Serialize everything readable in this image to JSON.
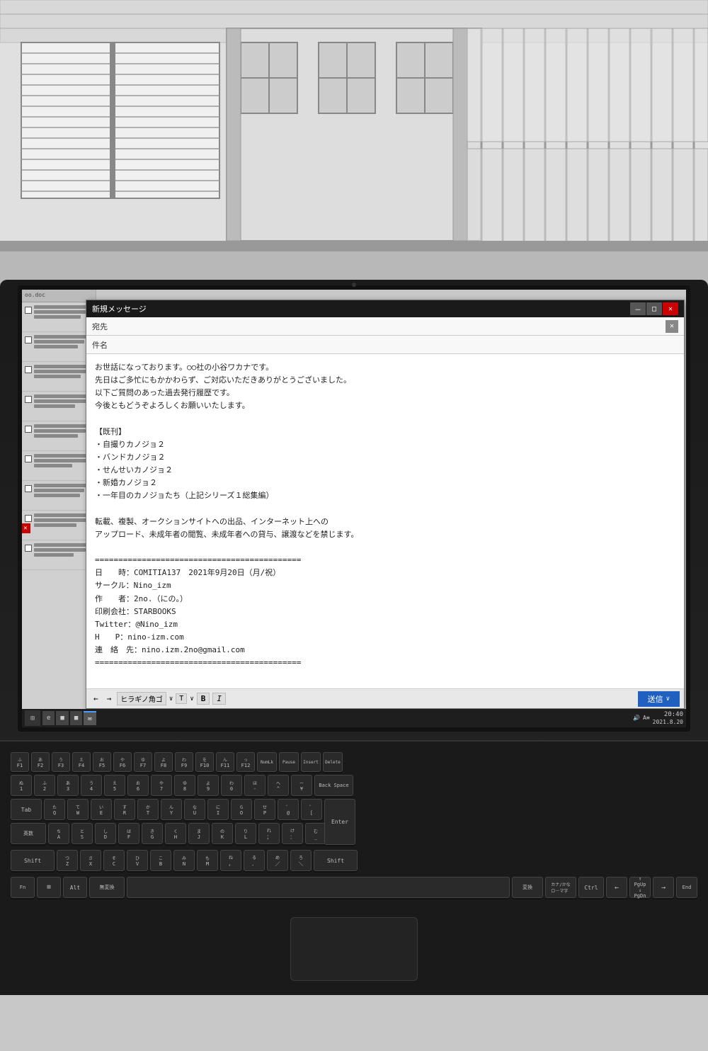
{
  "scene": {
    "background": "manga-style building interior with venetian blinds and windows"
  },
  "window": {
    "title": "新規メッセージ",
    "minimize_label": "－",
    "maximize_label": "□",
    "close_label": "✕"
  },
  "email": {
    "to_label": "宛先",
    "subject_label": "件名",
    "to_value": "",
    "subject_value": "",
    "close_x": "✕",
    "body": "お世話になっております。○○社の小谷ワカナです。\n先日はご多忙にもかかわらず、ご対応いただきありがとうございました。\n以下ご質問のあった過去発行履歴です。\n今後ともどうぞよろしくお願いいたします。\n\n【既刊】\n・自撮りカノジョ２\n・バンドカノジョ２\n・せんせいカノジョ２\n・新婚カノジョ２\n・一年目のカノジョたち（上記シリーズ１総集編）\n\n転載、複製、オークションサイトへの出品、インターネット上への\nアップロード、未成年者の閲覧、未成年者への貸与、譲渡などを禁じます。\n\n============================================\n日　　時：COMITIA137　2021年9月20日（月/祝）\nサークル：Nino_izm\n作　　者：2no.（にの。）\n印刷会社：STARBOOKS\nTwitter：@Nino_izm\nH　　P：nino-izm.com\n連　絡　先：nino.izm.2no@gmail.com\n============================================",
    "send_label": "送信"
  },
  "format_toolbar": {
    "arrow_left": "←",
    "arrow_right": "→",
    "font_label": "ヒラギノ角ゴ",
    "font_dropdown": "∨",
    "text_label": "T",
    "text_dropdown": "∨",
    "bold_label": "B",
    "italic_label": "I"
  },
  "taskbar": {
    "start_icon": "⊞",
    "items": [
      {
        "label": "e"
      },
      {
        "label": "■"
      },
      {
        "label": "■"
      },
      {
        "label": "✉"
      }
    ],
    "time": "20:40",
    "date": "2021.8.20",
    "battery_icon": "🔊",
    "network_icon": "A≡"
  },
  "left_panel": {
    "items": [
      {
        "checked": false,
        "lines": [
          3
        ]
      },
      {
        "checked": false,
        "lines": [
          3
        ]
      },
      {
        "checked": false,
        "lines": [
          3
        ]
      },
      {
        "checked": false,
        "lines": [
          3
        ]
      },
      {
        "checked": false,
        "lines": [
          3
        ]
      },
      {
        "checked": false,
        "lines": [
          3
        ]
      },
      {
        "checked": false,
        "lines": [
          3
        ]
      },
      {
        "checked": false,
        "lines": [
          3
        ]
      },
      {
        "checked": false,
        "lines": [
          3
        ]
      }
    ]
  },
  "keyboard": {
    "row1": [
      "F1",
      "F2",
      "F3",
      "F4",
      "F5",
      "F6",
      "F7",
      "F8",
      "F9",
      "F10",
      "F11",
      "F12",
      "NumLk",
      "Pause",
      "Insert",
      "Delete"
    ],
    "row2": [
      "1",
      "2",
      "3",
      "4",
      "5",
      "6",
      "7",
      "8",
      "9",
      "0",
      "-",
      "^",
      "¥",
      "BS"
    ],
    "row3": [
      "Tab",
      "Q",
      "W",
      "E",
      "R",
      "T",
      "Y",
      "U",
      "I",
      "O",
      "P",
      "@",
      "[",
      "Enter"
    ],
    "row4": [
      "英数",
      "A",
      "S",
      "D",
      "F",
      "G",
      "H",
      "J",
      "K",
      "L",
      ";",
      ":",
      "_",
      "Enter"
    ],
    "row5": [
      "Shift",
      "Z",
      "X",
      "C",
      "V",
      "B",
      "N",
      "M",
      ",",
      ".",
      "/",
      "\\",
      "Shift"
    ],
    "row6": [
      "Fn",
      "Win",
      "Alt",
      "無変換",
      "Space",
      "変換",
      "カナ/かな",
      "Ctrl",
      "←",
      "↑↓",
      "→",
      "End"
    ]
  }
}
